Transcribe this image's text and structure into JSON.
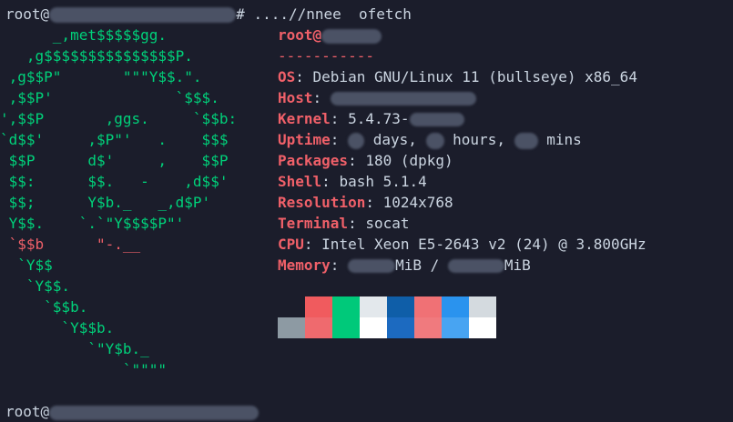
{
  "prompt": {
    "top_user": "root@",
    "top_cmd": "# ....//nnee  ofetch",
    "bottom_user": "root@"
  },
  "logo": [
    "      _,met$$$$$gg.",
    "   ,g$$$$$$$$$$$$$$$P.",
    " ,g$$P\"       \"\"\"Y$$.\".",
    " ,$$P'              `$$$.",
    "',$$P       ,ggs.     `$$b:",
    "`d$$'     ,$P\"'   .    $$$",
    " $$P      d$'     ,    $$P",
    " $$:      $$.   -    ,d$$'",
    " $$;      Y$b._   _,d$P'",
    " Y$$.    `.`\"Y$$$$P\"'",
    " `$$b      \"-.__",
    "  `Y$$",
    "   `Y$$.",
    "     `$$b.",
    "       `Y$$b.",
    "          `\"Y$b._",
    "              `\"\"\"\""
  ],
  "info": {
    "user": "root@",
    "separator": "-----------",
    "os_label": "OS",
    "os_value": "Debian GNU/Linux 11 (bullseye) x86_64",
    "host_label": "Host",
    "kernel_label": "Kernel",
    "kernel_value": "5.4.73-",
    "uptime_label": "Uptime",
    "uptime_days": "days,",
    "uptime_hours": "hours,",
    "uptime_mins": "mins",
    "packages_label": "Packages",
    "packages_value": "180 (dpkg)",
    "shell_label": "Shell",
    "shell_value": "bash 5.1.4",
    "resolution_label": "Resolution",
    "resolution_value": "1024x768",
    "terminal_label": "Terminal",
    "terminal_value": "socat",
    "cpu_label": "CPU",
    "cpu_value": "Intel Xeon E5-2643 v2 (24) @ 3.800GHz",
    "memory_label": "Memory",
    "memory_sep": "MiB / ",
    "memory_unit": "MiB"
  },
  "palette": {
    "row1": [
      "#1b1d2b",
      "#f05b5e",
      "#00c97a",
      "#e3e8ec",
      "#0f5ea8",
      "#f07175",
      "#2a93ee",
      "#d4dadf"
    ],
    "row2": [
      "#8d9aa3",
      "#ef6a6e",
      "#00c97a",
      "#ffffff",
      "#1c6ac0",
      "#f07a7e",
      "#48a4f2",
      "#ffffff"
    ]
  }
}
